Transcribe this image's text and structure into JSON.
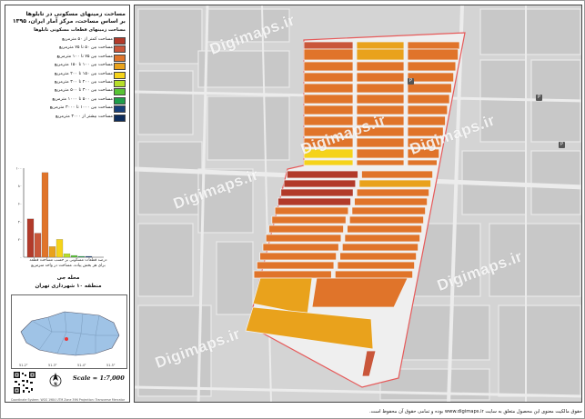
{
  "title_lines": [
    "مساحت زمینهای مسکونی در تابلوها",
    "بر اساس مساحت، مرکز آمار ایران، ۱۳۹۵"
  ],
  "legend": {
    "title": "مساحت زمینهای قطعات مسکونی تابلوها",
    "items": [
      {
        "label": "مساحت کمتر از ۵۰ مترمربع",
        "color": "#b23a2a"
      },
      {
        "label": "مساحت بین ۵۰ تا ۷۵ مترمربع",
        "color": "#c9563a"
      },
      {
        "label": "مساحت بین ۷۵ تا ۱۰۰ مترمربع",
        "color": "#e0742a"
      },
      {
        "label": "مساحت بین ۱۰۰ تا ۱۵۰ مترمربع",
        "color": "#e9a21c"
      },
      {
        "label": "مساحت بین ۱۵۰ تا ۲۰۰ مترمربع",
        "color": "#f5d31a"
      },
      {
        "label": "مساحت بین ۲۰۰ تا ۳۰۰ مترمربع",
        "color": "#b6de2a"
      },
      {
        "label": "مساحت بین ۳۰۰ تا ۵۰۰ مترمربع",
        "color": "#58c435"
      },
      {
        "label": "مساحت بین ۵۰۰ تا ۱۰۰۰ مترمربع",
        "color": "#1f9e4a"
      },
      {
        "label": "مساحت بین ۱۰۰۰ تا ۳۰۰۰ مترمربع",
        "color": "#173f7a"
      },
      {
        "label": "مساحت بیشتر از ۳۰۰۰ مترمربع",
        "color": "#0d2c5c"
      }
    ]
  },
  "chart_data": {
    "type": "bar",
    "categories": [
      "<50",
      "50-75",
      "75-100",
      "100-150",
      "150-200",
      "200-300",
      "300-500",
      "500-1000",
      "1000-3000",
      ">3000"
    ],
    "values": [
      43,
      27,
      95,
      12,
      20,
      4,
      2,
      1,
      1,
      0
    ],
    "colors": [
      "#b23a2a",
      "#c9563a",
      "#e0742a",
      "#e9a21c",
      "#f5d31a",
      "#b6de2a",
      "#58c435",
      "#1f9e4a",
      "#173f7a",
      "#0d2c5c"
    ],
    "yticks": [
      "۱۰۰",
      "۸۰",
      "۶۰",
      "۴۰",
      "۲۰",
      "۰"
    ],
    "ylim": [
      0,
      100
    ],
    "caption_lines": [
      "درصد قطعات مسکونی بر حسب مساحت قطعه",
      "برای هر بخش پیاده، مساحت در واحد مترمربع"
    ]
  },
  "place": {
    "line1": "محله جی",
    "line2": "منطقه ۱۰ شهرداری تهران"
  },
  "scale": "Scale = 1:7,000",
  "watermark": "Digimaps.ir",
  "footer": "حقوق مالکیت معنوی این محصول متعلق به سایت www.digimaps.ir بوده و تمامی حقوق آن محفوظ است.",
  "inset_ticks": [
    "51.2°",
    "51.3°",
    "51.4°",
    "51.5°"
  ],
  "tiny_note": "Coordinate System: WGS 1984 UTM Zone 39N   Projection: Transverse Mercator",
  "poi_icons": [
    "parking-icon",
    "parking-icon",
    "parking-icon"
  ]
}
